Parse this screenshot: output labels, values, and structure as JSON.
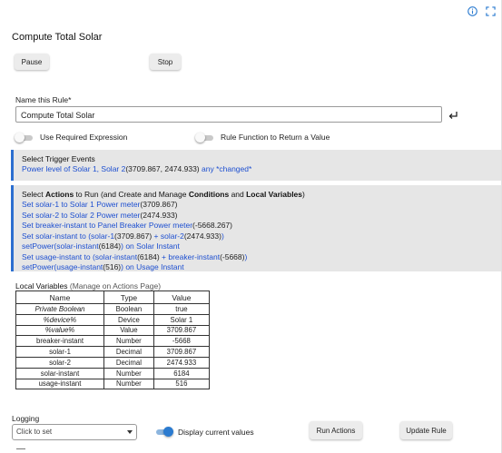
{
  "page": {
    "title": "Compute Total Solar"
  },
  "header_icons": [
    "info-icon",
    "expand-icon"
  ],
  "buttons": {
    "pause": "Pause",
    "stop": "Stop",
    "run_actions": "Run Actions",
    "update_rule": "Update Rule"
  },
  "rule_name": {
    "label": "Name this Rule*",
    "value": "Compute Total Solar"
  },
  "toggles": {
    "required_expression": {
      "label": "Use Required Expression",
      "on": false
    },
    "rule_function": {
      "label": "Rule Function to Return a Value",
      "on": false
    },
    "display_values": {
      "label": "Display current values",
      "on": true
    }
  },
  "triggers": {
    "heading": "Select Trigger Events",
    "line_prefix": "Power level of Solar 1, Solar 2",
    "line_value": "(3709.867, 2474.933)",
    "line_suffix": " any *changed*"
  },
  "actions": {
    "heading_parts": [
      "Select ",
      "Actions",
      " to Run (and Create and Manage ",
      "Conditions",
      " and ",
      "Local Variables",
      ")"
    ],
    "lines": [
      [
        {
          "t": "Set solar-1 to Solar 1 Power meter"
        },
        {
          "t": "(3709.867)",
          "v": true
        }
      ],
      [
        {
          "t": "Set solar-2 to Solar 2 Power meter"
        },
        {
          "t": "(2474.933)",
          "v": true
        }
      ],
      [
        {
          "t": "Set breaker-instant to Panel Breaker Power meter"
        },
        {
          "t": "(-5668.267)",
          "v": true
        }
      ],
      [
        {
          "t": "Set solar-instant to (solar-1"
        },
        {
          "t": "(3709.867)",
          "v": true
        },
        {
          "t": " + solar-2"
        },
        {
          "t": "(2474.933)",
          "v": true
        },
        {
          "t": ")"
        }
      ],
      [
        {
          "t": "setPower(solar-instant"
        },
        {
          "t": "(6184)",
          "v": true
        },
        {
          "t": ") on Solar Instant"
        }
      ],
      [
        {
          "t": "Set usage-instant to (solar-instant"
        },
        {
          "t": "(6184)",
          "v": true
        },
        {
          "t": " + breaker-instant"
        },
        {
          "t": "(-5668)",
          "v": true
        },
        {
          "t": ")"
        }
      ],
      [
        {
          "t": "setPower(usage-instant"
        },
        {
          "t": "(516)",
          "v": true
        },
        {
          "t": ") on Usage Instant"
        }
      ]
    ]
  },
  "local_variables": {
    "title": "Local Variables",
    "subtitle": " (Manage on Actions Page)",
    "columns": [
      "Name",
      "Type",
      "Value"
    ],
    "rows": [
      {
        "name": "Private Boolean",
        "type": "Boolean",
        "value": "true",
        "italic": true
      },
      {
        "name": "%device%",
        "type": "Device",
        "value": "Solar 1",
        "italic": true
      },
      {
        "name": "%value%",
        "type": "Value",
        "value": "3709.867",
        "italic": true
      },
      {
        "name": "breaker-instant",
        "type": "Number",
        "value": "-5668",
        "italic": false
      },
      {
        "name": "solar-1",
        "type": "Decimal",
        "value": "3709.867",
        "italic": false
      },
      {
        "name": "solar-2",
        "type": "Decimal",
        "value": "2474.933",
        "italic": false
      },
      {
        "name": "solar-instant",
        "type": "Number",
        "value": "6184",
        "italic": false
      },
      {
        "name": "usage-instant",
        "type": "Number",
        "value": "516",
        "italic": false
      }
    ]
  },
  "logging": {
    "label": "Logging",
    "placeholder": "Click to set"
  },
  "colors": {
    "link": "#1d4fd0",
    "accent": "#2b7bd0",
    "panel_bg": "#e6e6e6",
    "panel_border": "#2c6fd0"
  }
}
